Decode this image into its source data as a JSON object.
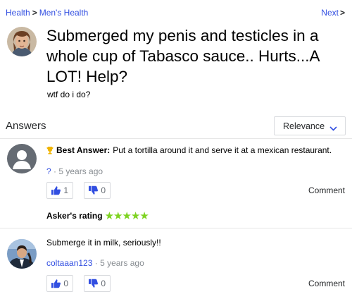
{
  "breadcrumb": {
    "category": "Health",
    "subcategory": "Men's Health",
    "separator": ">"
  },
  "nav": {
    "next_label": "Next",
    "next_chevron": ">"
  },
  "question": {
    "title": "Submerged my penis and testicles in a whole cup of Tabasco sauce.. Hurts...A LOT! Help?",
    "detail": "wtf do i do?"
  },
  "answers_section": {
    "heading": "Answers",
    "sort_value": "Relevance"
  },
  "answers": [
    {
      "best_answer_label": "Best Answer:",
      "text": "Put a tortilla around it and serve it at a mexican restaurant.",
      "author": "?",
      "time": "5 years ago",
      "upvotes": "1",
      "downvotes": "0",
      "comment_label": "Comment",
      "asker_rating_label": "Asker's rating",
      "asker_rating_stars": "★★★★★",
      "rating_value": 5
    },
    {
      "text": "Submerge it in milk, seriously!!",
      "author": "coltaaan123",
      "time": "5 years ago",
      "upvotes": "0",
      "downvotes": "0",
      "comment_label": "Comment"
    }
  ],
  "colors": {
    "link": "#324fe1",
    "star": "#7ed321",
    "trophy": "#f0b400"
  },
  "icons": [
    "question-avatar",
    "default-user-icon",
    "trophy-icon",
    "thumbs-up-icon",
    "thumbs-down-icon",
    "chevron-down-icon"
  ]
}
